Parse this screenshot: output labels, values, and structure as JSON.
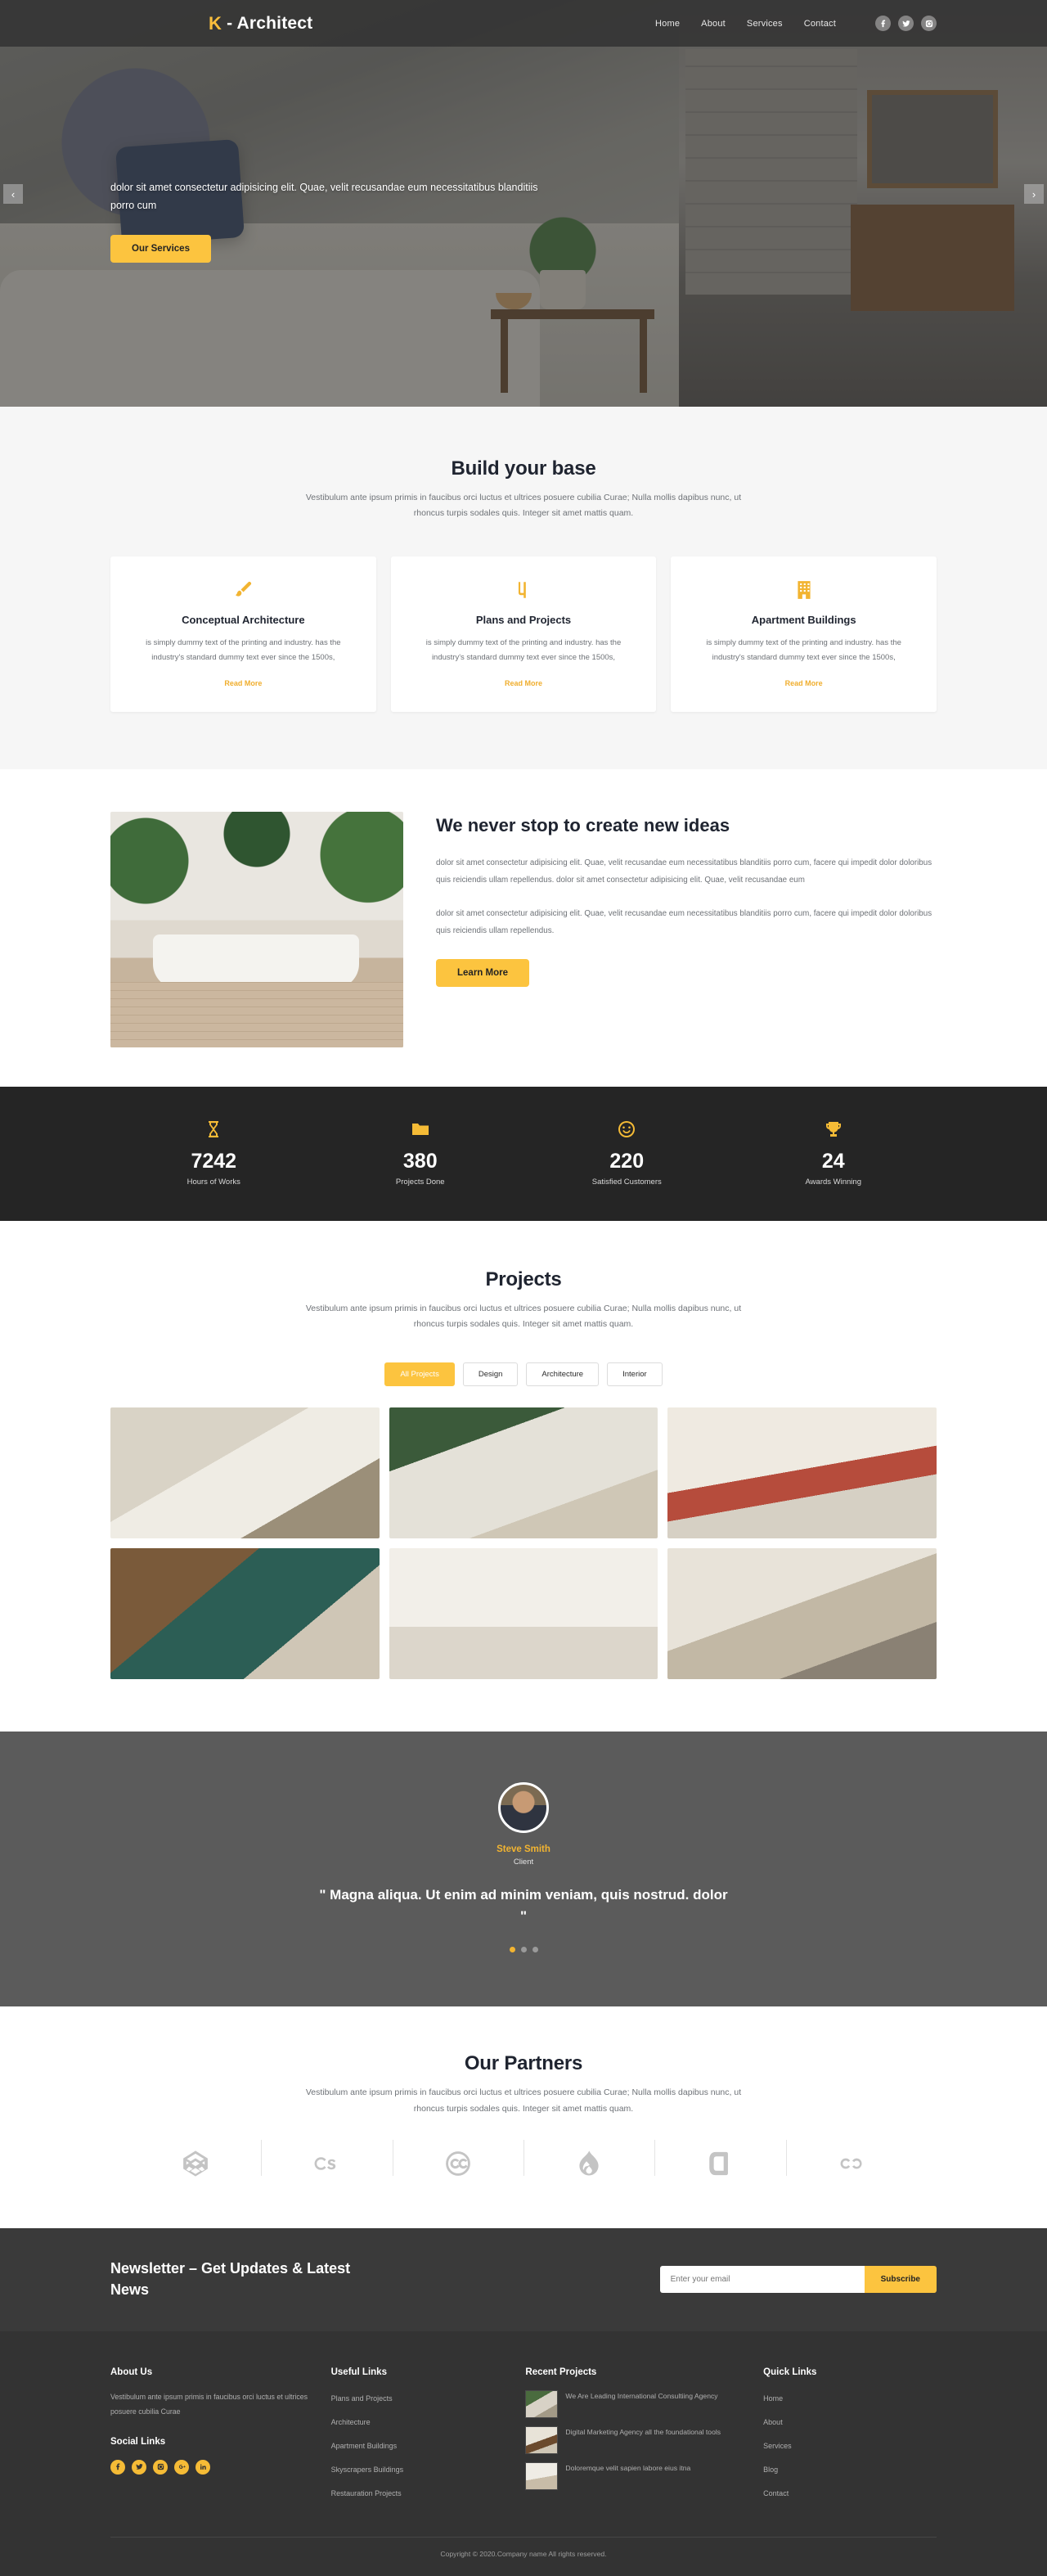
{
  "header": {
    "logo_mark": "architect-logo-icon",
    "logo_text": "- Architect",
    "nav": [
      {
        "label": "Home"
      },
      {
        "label": "About"
      },
      {
        "label": "Services"
      },
      {
        "label": "Contact"
      }
    ],
    "social": [
      {
        "name": "facebook-icon"
      },
      {
        "name": "twitter-icon"
      },
      {
        "name": "instagram-icon"
      }
    ]
  },
  "hero": {
    "text": "dolor sit amet consectetur adipisicing elit. Quae, velit recusandae eum necessitatibus blanditiis porro cum",
    "cta": "Our Services",
    "prev": "‹",
    "next": "›"
  },
  "build": {
    "title": "Build your base",
    "subtitle": "Vestibulum ante ipsum primis in faucibus orci luctus et ultrices posuere cubilia Curae; Nulla mollis dapibus nunc, ut rhoncus turpis sodales quis. Integer sit amet mattis quam.",
    "cards": [
      {
        "icon": "paintbrush-icon",
        "title": "Conceptual Architecture",
        "body": "is simply dummy text of the printing and industry. has the industry's standard dummy text ever since the 1500s,",
        "link": "Read More"
      },
      {
        "icon": "drafting-plan-icon",
        "title": "Plans and Projects",
        "body": "is simply dummy text of the printing and industry. has the industry's standard dummy text ever since the 1500s,",
        "link": "Read More"
      },
      {
        "icon": "building-icon",
        "title": "Apartment Buildings",
        "body": "is simply dummy text of the printing and industry. has the industry's standard dummy text ever since the 1500s,",
        "link": "Read More"
      }
    ]
  },
  "ideas": {
    "image_alt": "bathroom-interior-photo",
    "heading": "We never stop to create new ideas",
    "paragraph1": "dolor sit amet consectetur adipisicing elit. Quae, velit recusandae eum necessitatibus blanditiis porro cum, facere qui impedit dolor doloribus quis reiciendis ullam repellendus. dolor sit amet consectetur adipisicing elit. Quae, velit recusandae eum",
    "paragraph2": "dolor sit amet consectetur adipisicing elit. Quae, velit recusandae eum necessitatibus blanditiis porro cum, facere qui impedit dolor doloribus quis reiciendis ullam repellendus.",
    "cta": "Learn More"
  },
  "stats": [
    {
      "icon": "hourglass-icon",
      "value": "7242",
      "label": "Hours of Works"
    },
    {
      "icon": "folder-icon",
      "value": "380",
      "label": "Projects Done"
    },
    {
      "icon": "smiley-icon",
      "value": "220",
      "label": "Satisfied Customers"
    },
    {
      "icon": "trophy-icon",
      "value": "24",
      "label": "Awards Winning"
    }
  ],
  "projects": {
    "title": "Projects",
    "subtitle": "Vestibulum ante ipsum primis in faucibus orci luctus et ultrices posuere cubilia Curae; Nulla mollis dapibus nunc, ut rhoncus turpis sodales quis. Integer sit amet mattis quam.",
    "filters": [
      {
        "label": "All Projects",
        "active": true
      },
      {
        "label": "Design",
        "active": false
      },
      {
        "label": "Architecture",
        "active": false
      },
      {
        "label": "Interior",
        "active": false
      }
    ],
    "items": [
      {
        "alt": "kitchen-white-cabinets"
      },
      {
        "alt": "living-room-green-wall"
      },
      {
        "alt": "living-room-red-sofa"
      },
      {
        "alt": "bathroom-teal-wall"
      },
      {
        "alt": "bright-window-room"
      },
      {
        "alt": "kitchen-pendant-lights"
      }
    ]
  },
  "testimonial": {
    "avatar_alt": "client-portrait",
    "name": "Steve Smith",
    "role": "Client",
    "quote": "\" Magna aliqua. Ut enim ad minim veniam, quis nostrud. dolor \"",
    "dots": [
      {
        "active": true
      },
      {
        "active": false
      },
      {
        "active": false
      }
    ]
  },
  "partners": {
    "title": "Our Partners",
    "subtitle": "Vestibulum ante ipsum primis in faucibus orci luctus et ultrices posuere cubilia Curae; Nulla mollis dapibus nunc, ut rhoncus turpis sodales quis. Integer sit amet mattis quam.",
    "logos": [
      {
        "name": "codepen-logo-icon"
      },
      {
        "name": "lastfm-logo-icon"
      },
      {
        "name": "creative-commons-logo-icon"
      },
      {
        "name": "drupal-logo-icon"
      },
      {
        "name": "dashcube-logo-icon"
      },
      {
        "name": "cloudscale-logo-icon"
      }
    ]
  },
  "newsletter": {
    "heading": "Newsletter – Get Updates & Latest News",
    "placeholder": "Enter your email",
    "value": "",
    "button": "Subscribe"
  },
  "footer": {
    "about": {
      "title": "About Us",
      "text": "Vestibulum ante ipsum primis in faucibus orci luctus et ultrices posuere cubilia Curae",
      "social_title": "Social Links",
      "social": [
        {
          "name": "facebook-icon"
        },
        {
          "name": "twitter-icon"
        },
        {
          "name": "instagram-icon"
        },
        {
          "name": "google-plus-icon"
        },
        {
          "name": "linkedin-icon"
        }
      ]
    },
    "useful": {
      "title": "Useful Links",
      "links": [
        {
          "label": "Plans and Projects"
        },
        {
          "label": "Architecture"
        },
        {
          "label": "Apartment Buildings"
        },
        {
          "label": "Skyscrapers Buildings"
        },
        {
          "label": "Restauration Projects"
        }
      ]
    },
    "recent": {
      "title": "Recent Projects",
      "items": [
        {
          "thumb": "project-thumb-1",
          "text": "We Are Leading International Consultiing Agency"
        },
        {
          "thumb": "project-thumb-2",
          "text": "Digital Marketing Agency all the foundational tools"
        },
        {
          "thumb": "project-thumb-3",
          "text": "Doloremque velit sapien labore eius itna"
        }
      ]
    },
    "quick": {
      "title": "Quick Links",
      "links": [
        {
          "label": "Home"
        },
        {
          "label": "About"
        },
        {
          "label": "Services"
        },
        {
          "label": "Blog"
        },
        {
          "label": "Contact"
        }
      ]
    },
    "copyright": "Copyright © 2020.Company name All rights reserved."
  },
  "colors": {
    "accent": "#fcc43f",
    "accent_dark": "#f2b431",
    "dark": "#333333",
    "darker": "#252525",
    "grey_section": "#5b5b5b"
  }
}
